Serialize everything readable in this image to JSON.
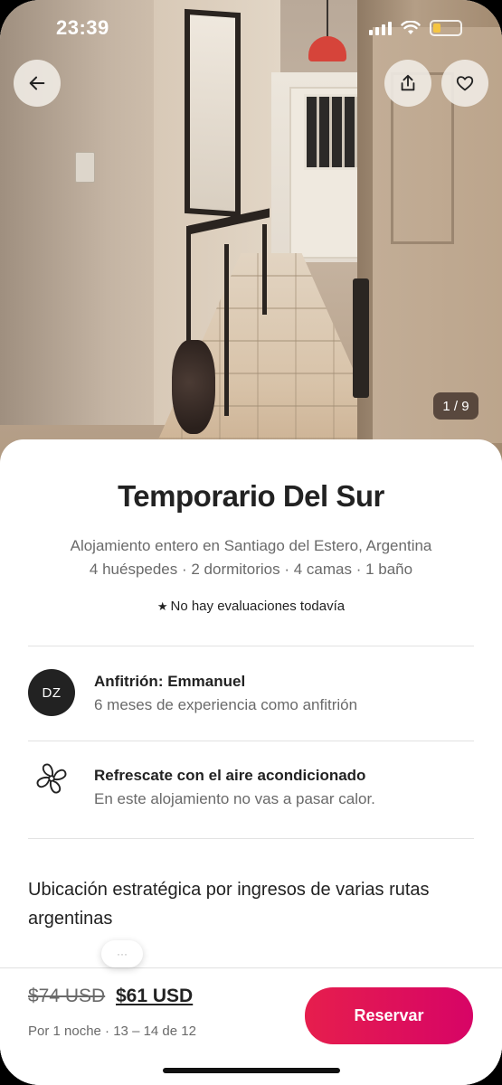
{
  "status_bar": {
    "time": "23:39"
  },
  "photo": {
    "counter": "1 / 9",
    "alt": "hallway photo"
  },
  "listing": {
    "title": "Temporario Del Sur",
    "subtitle": "Alojamiento entero en Santiago del Estero, Argentina",
    "details": "4 huéspedes · 2 dormitorios · 4 camas · 1 baño",
    "reviews": "No hay evaluaciones todavía"
  },
  "host": {
    "initials": "DZ",
    "title": "Anfitrión: Emmanuel",
    "experience": "6 meses de experiencia como anfitrión"
  },
  "highlight": {
    "icon": "fan-icon",
    "title": "Refrescate con el aire acondicionado",
    "subtitle": "En este alojamiento no vas a pasar calor."
  },
  "description": "Ubicación estratégica por ingresos de varias rutas argentinas",
  "footer": {
    "old_price": "$74 USD",
    "new_price": "$61 USD",
    "dates": "Por 1  noche · 13 – 14 de 12",
    "reserve_label": "Reservar"
  },
  "colors": {
    "accent": "#E61E4D",
    "text": "#222222",
    "muted": "#6A6A6A"
  }
}
